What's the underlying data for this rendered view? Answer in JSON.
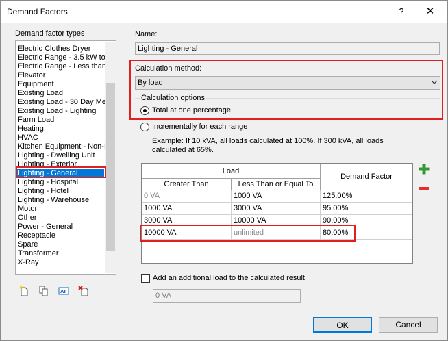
{
  "window": {
    "title": "Demand Factors",
    "help": "?",
    "close": "✕"
  },
  "left": {
    "label": "Demand factor types",
    "items": [
      "Electric Clothes Dryer",
      "Electric Range - 3.5 kW to",
      "Electric Range - Less than",
      "Elevator",
      "Equipment",
      "Existing Load",
      "Existing Load - 30 Day Met",
      "Existing Load - Lighting",
      "Farm Load",
      "Heating",
      "HVAC",
      "Kitchen Equipment - Non-D",
      "Lighting - Dwelling Unit",
      "Lighting - Exterior",
      "Lighting - General",
      "Lighting - Hospital",
      "Lighting - Hotel",
      "Lighting - Warehouse",
      "Motor",
      "Other",
      "Power - General",
      "Receptacle",
      "Spare",
      "Transformer",
      "X-Ray"
    ],
    "selected_index": 14
  },
  "name": {
    "label": "Name:",
    "value": "Lighting - General"
  },
  "method": {
    "label": "Calculation method:",
    "value": "By load"
  },
  "options": {
    "label": "Calculation options",
    "total": "Total at one percentage",
    "incremental": "Incrementally for each range",
    "example_line1": "Example: If 10 kVA, all loads calculated at 100%. If 300 kVA, all loads",
    "example_line2": "calculated at 65%."
  },
  "table": {
    "group_header": "Load",
    "col_greater": "Greater Than",
    "col_less": "Less Than or Equal To",
    "col_factor": "Demand Factor",
    "rows": [
      {
        "greater": "0 VA",
        "less": "1000 VA",
        "factor": "125.00%"
      },
      {
        "greater": "1000 VA",
        "less": "3000 VA",
        "factor": "95.00%"
      },
      {
        "greater": "3000 VA",
        "less": "10000 VA",
        "factor": "90.00%"
      },
      {
        "greater": "10000 VA",
        "less": "unlimited",
        "factor": "80.00%"
      }
    ]
  },
  "additional": {
    "label": "Add an additional load to the calculated result",
    "value": "0 VA"
  },
  "buttons": {
    "ok": "OK",
    "cancel": "Cancel"
  },
  "icons": [
    "new-icon",
    "duplicate-icon",
    "rename-icon",
    "delete-icon",
    "plus-icon",
    "minus-icon"
  ],
  "colors": {
    "selection": "#0078d7",
    "highlight_box": "#e02020",
    "plus": "#2f9e2f",
    "minus": "#e03030"
  }
}
